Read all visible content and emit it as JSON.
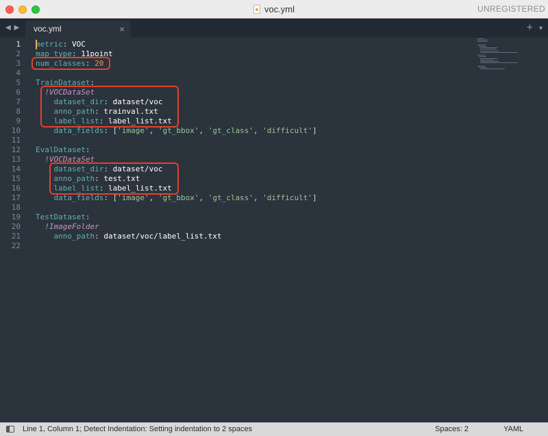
{
  "window": {
    "title": "voc.yml",
    "status_right": "UNREGISTERED"
  },
  "tabbar": {
    "nav_arrows": "◀ ▶",
    "tabs": [
      {
        "label": "voc.yml",
        "close": "×"
      }
    ],
    "plus": "+",
    "menu": "▼"
  },
  "editor": {
    "lines": [
      {
        "n": "1",
        "key": "metric",
        "sep": ": ",
        "val": "VOC"
      },
      {
        "n": "2",
        "key": "map_type",
        "sep": ": ",
        "val": "11point"
      },
      {
        "n": "3",
        "key": "num_classes",
        "sep": ": ",
        "num": "20"
      },
      {
        "n": "4"
      },
      {
        "n": "5",
        "key": "TrainDataset",
        "sep": ":"
      },
      {
        "n": "6",
        "indent": "  ",
        "tag": "!VOCDataSet"
      },
      {
        "n": "7",
        "indent": "    ",
        "key": "dataset_dir",
        "sep": ": ",
        "val": "dataset/voc"
      },
      {
        "n": "8",
        "indent": "    ",
        "key": "anno_path",
        "sep": ": ",
        "val": "trainval.txt"
      },
      {
        "n": "9",
        "indent": "    ",
        "key": "label_list",
        "sep": ": ",
        "val": "label_list.txt"
      },
      {
        "n": "10",
        "indent": "    ",
        "key": "data_fields",
        "sep": ": ",
        "list": [
          "'image'",
          "'gt_bbox'",
          "'gt_class'",
          "'difficult'"
        ]
      },
      {
        "n": "11"
      },
      {
        "n": "12",
        "key": "EvalDataset",
        "sep": ":"
      },
      {
        "n": "13",
        "indent": "  ",
        "tag": "!VOCDataSet"
      },
      {
        "n": "14",
        "indent": "    ",
        "key": "dataset_dir",
        "sep": ": ",
        "val": "dataset/voc"
      },
      {
        "n": "15",
        "indent": "    ",
        "key": "anno_path",
        "sep": ": ",
        "val": "test.txt"
      },
      {
        "n": "16",
        "indent": "    ",
        "key": "label_list",
        "sep": ": ",
        "val": "label_list.txt"
      },
      {
        "n": "17",
        "indent": "    ",
        "key": "data_fields",
        "sep": ": ",
        "list": [
          "'image'",
          "'gt_bbox'",
          "'gt_class'",
          "'difficult'"
        ]
      },
      {
        "n": "18"
      },
      {
        "n": "19",
        "key": "TestDataset",
        "sep": ":"
      },
      {
        "n": "20",
        "indent": "  ",
        "tag": "!ImageFolder"
      },
      {
        "n": "21",
        "indent": "    ",
        "key": "anno_path",
        "sep": ": ",
        "val": "dataset/voc/label_list.txt"
      },
      {
        "n": "22"
      }
    ],
    "highlights": [
      {
        "name": "highlight-num-classes",
        "from_line": 3,
        "to_line": 3
      },
      {
        "name": "highlight-train-dataset-paths",
        "from_line": 6,
        "to_line": 9
      },
      {
        "name": "highlight-eval-dataset-paths",
        "from_line": 14,
        "to_line": 16
      }
    ]
  },
  "statusbar": {
    "message": "Line 1, Column 1; Detect Indentation: Setting indentation to 2 spaces",
    "spaces": "Spaces: 2",
    "syntax": "YAML"
  },
  "colors": {
    "editor_bg": "#2b333d",
    "key": "#5fb3b3",
    "number": "#f99157",
    "tag": "#c594c5",
    "string": "#99c794",
    "highlight_border": "#e5412b",
    "cursor": "#e6b45a"
  }
}
